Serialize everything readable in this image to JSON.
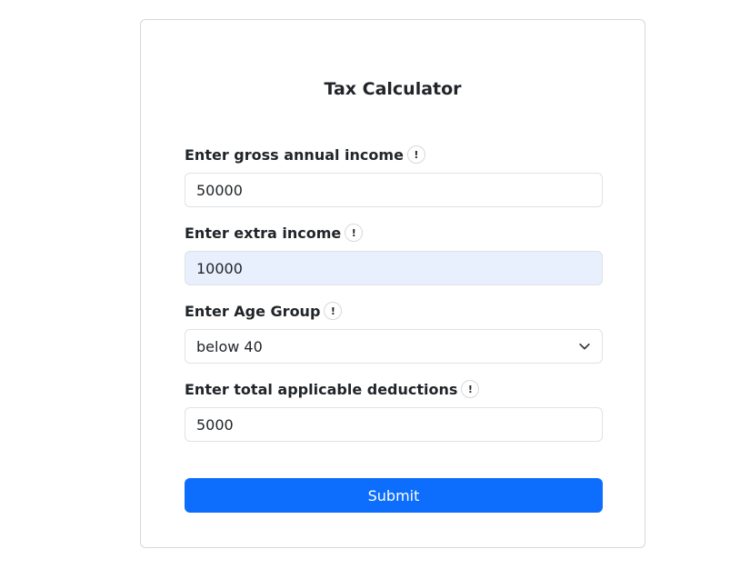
{
  "form": {
    "title": "Tax Calculator",
    "fields": [
      {
        "label": "Enter gross annual income",
        "value": "50000",
        "info_icon": "!"
      },
      {
        "label": "Enter extra income",
        "value": "10000",
        "info_icon": "!"
      },
      {
        "label": "Enter Age Group",
        "value": "below 40",
        "info_icon": "!"
      },
      {
        "label": "Enter total applicable deductions",
        "value": "5000",
        "info_icon": "!"
      }
    ],
    "submit_label": "Submit"
  },
  "colors": {
    "primary": "#0d6efd",
    "autofill_bg": "#e8f0fe",
    "border": "#dee2e6"
  }
}
